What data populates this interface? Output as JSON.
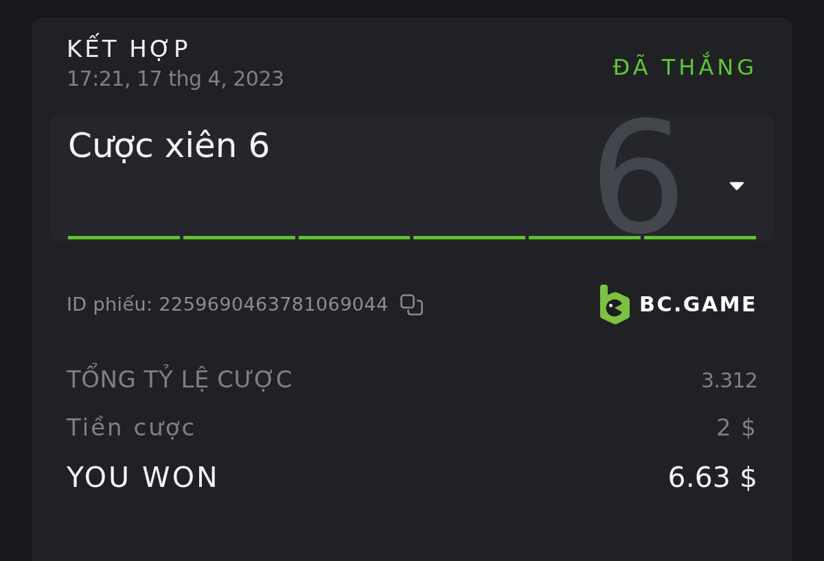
{
  "bet": {
    "type_label": "KẾT HỢP",
    "datetime": "17:21, 17 thg 4, 2023",
    "status": {
      "label": "ĐÃ THẮNG",
      "kind": "won"
    }
  },
  "parlay": {
    "title": "Cược xiên 6",
    "count": "6",
    "expanded": false,
    "legs": [
      {
        "kind": "won"
      },
      {
        "kind": "won"
      },
      {
        "kind": "won"
      },
      {
        "kind": "won"
      },
      {
        "kind": "won"
      },
      {
        "kind": "won"
      }
    ]
  },
  "ticket": {
    "id_text": "ID phiếu: 2259690463781069044"
  },
  "brand": {
    "name": "BC.GAME"
  },
  "summary": [
    {
      "kind": "odds",
      "label": "TỔNG TỶ LỆ CƯỢC",
      "value": "3.312"
    },
    {
      "kind": "stake",
      "label": "Tiền cược",
      "value": "2 $"
    },
    {
      "kind": "payout",
      "label": "YOU WON",
      "value": "6.63 $"
    }
  ]
}
